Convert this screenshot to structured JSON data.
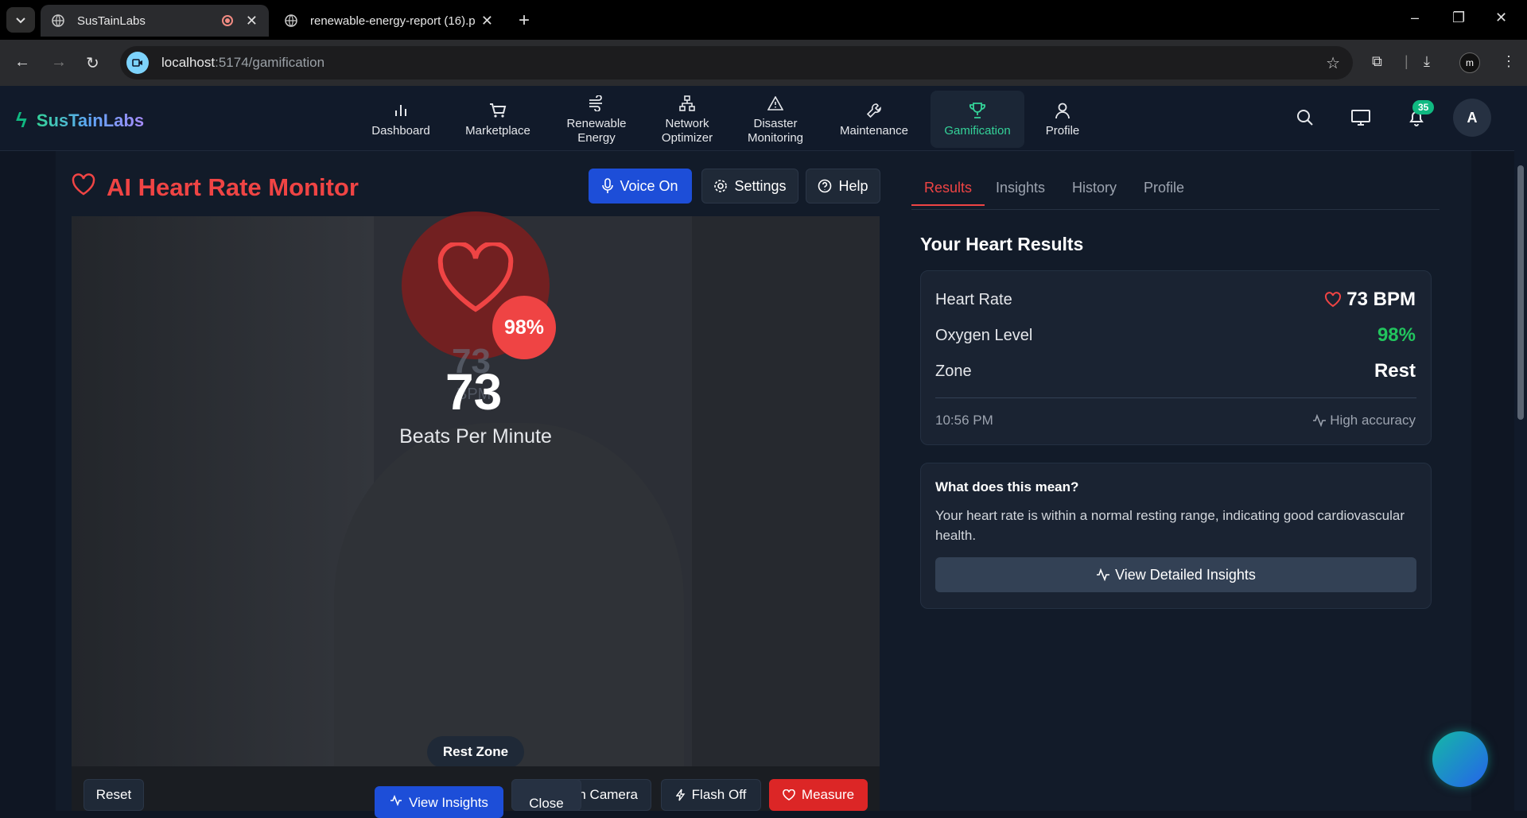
{
  "browser": {
    "tabs": [
      {
        "title": "SusTainLabs",
        "active": true
      },
      {
        "title": "renewable-energy-report (16).p",
        "active": false
      }
    ],
    "url_host": "localhost",
    "url_rest": ":5174/gamification",
    "win_minimize": "–",
    "win_restore": "❐",
    "win_close": "✕",
    "profile_initial": "m"
  },
  "app": {
    "logo": "SusTainLabs",
    "nav": [
      {
        "label": "Dashboard",
        "icon": "bar-chart-icon"
      },
      {
        "label": "Marketplace",
        "icon": "cart-icon"
      },
      {
        "label": "Renewable Energy",
        "icon": "wind-icon"
      },
      {
        "label": "Network Optimizer",
        "icon": "network-icon"
      },
      {
        "label": "Disaster Monitoring",
        "icon": "warning-icon"
      },
      {
        "label": "Maintenance",
        "icon": "wrench-icon"
      },
      {
        "label": "Gamification",
        "icon": "trophy-icon",
        "active": true
      },
      {
        "label": "Profile",
        "icon": "user-icon"
      }
    ],
    "notifications_count": "35",
    "avatar_initial": "A",
    "accent": "#10b981"
  },
  "monitor": {
    "title": "AI Heart Rate Monitor",
    "voice_label": "Voice On",
    "settings_label": "Settings",
    "help_label": "Help",
    "oxygen_badge": "98%",
    "ghost_bpm_value": "73",
    "ghost_bpm_unit": "BPM",
    "bpm_value": "73",
    "bpm_label": "Beats Per Minute",
    "zone_pill": "Rest Zone",
    "buttons": {
      "reset": "Reset",
      "view_insights": "View Insights",
      "close": "Close",
      "switch_camera": "h Camera",
      "flash": "Flash Off",
      "measure": "Measure"
    }
  },
  "results": {
    "tabs": [
      "Results",
      "Insights",
      "History",
      "Profile"
    ],
    "heading": "Your Heart Results",
    "heart_rate_label": "Heart Rate",
    "heart_rate_value": "73 BPM",
    "oxygen_label": "Oxygen Level",
    "oxygen_value": "98%",
    "zone_label": "Zone",
    "zone_value": "Rest",
    "time": "10:56 PM",
    "accuracy": "High accuracy",
    "meaning_heading": "What does this mean?",
    "meaning_text": "Your heart rate is within a normal resting range, indicating good cardiovascular health.",
    "detail_button": "View Detailed Insights",
    "colors": {
      "heart": "#ef4444",
      "oxygen": "#22c55e"
    }
  }
}
